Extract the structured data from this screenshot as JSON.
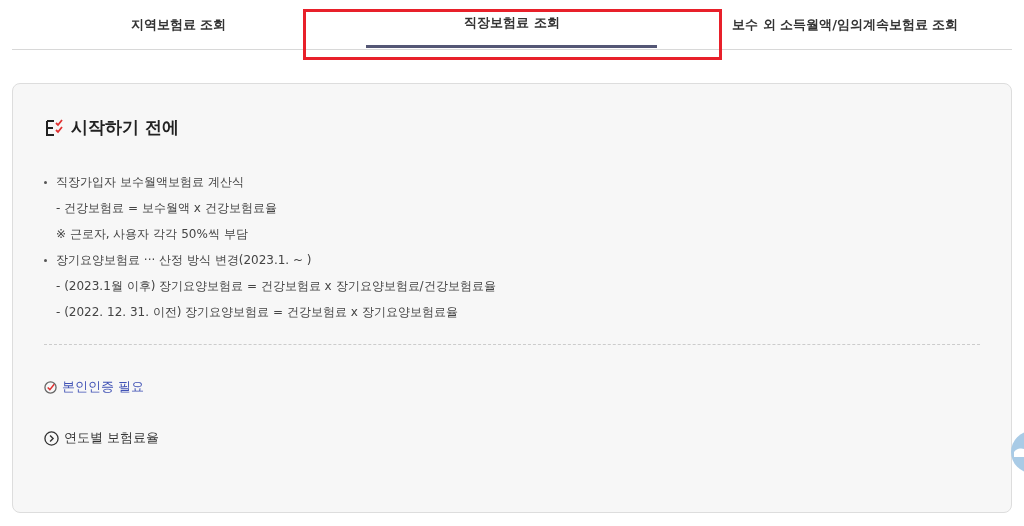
{
  "tabs": [
    {
      "label": "지역보험료 조회",
      "selected": false,
      "highlighted": false
    },
    {
      "label": "직장보험료 조회",
      "selected": true,
      "highlighted": true
    },
    {
      "label": "보수 외 소득월액/임의계속보험료 조회",
      "selected": false,
      "highlighted": false
    }
  ],
  "notice": {
    "title": "시작하기 전에",
    "lines": [
      {
        "kind": "bullet",
        "text": "직장가입자 보수월액보험료 계산식"
      },
      {
        "kind": "sub",
        "text": "- 건강보험료 = 보수월액 x 건강보험료율"
      },
      {
        "kind": "sub",
        "text": "※ 근로자, 사용자 각각 50%씩 부담"
      },
      {
        "kind": "bullet",
        "text": "장기요양보험료 ··· 산정 방식 변경(2023.1. ~ )"
      },
      {
        "kind": "sub",
        "text": "- (2023.1월 이후) 장기요양보험료 = 건강보험료 x 장기요양보험료/건강보험료율"
      },
      {
        "kind": "sub",
        "text": "- (2022. 12. 31. 이전) 장기요양보험료 = 건강보험료 x 장기요양보험료율"
      }
    ],
    "auth_link": "본인인증 필요",
    "rates_link": "연도별 보험료율"
  }
}
